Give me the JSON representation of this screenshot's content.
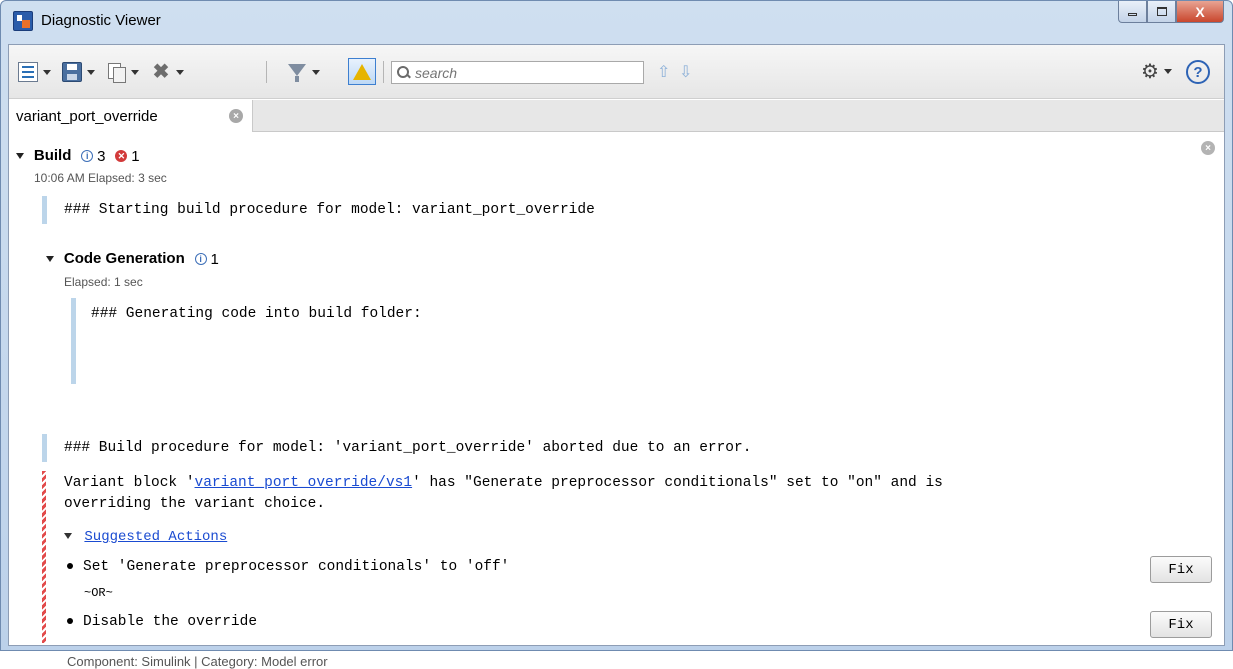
{
  "window": {
    "title": "Diagnostic Viewer",
    "minimize": "",
    "maximize": "",
    "close": "X"
  },
  "toolbar": {
    "search_placeholder": "search",
    "icons": [
      "list-icon",
      "save-icon",
      "copy-icon",
      "delete-icon",
      "filter-icon",
      "warning-toggle-icon",
      "up-arrow-icon",
      "down-arrow-icon",
      "gear-icon",
      "help-icon"
    ],
    "help_label": "?"
  },
  "tabs": [
    {
      "label": "variant_port_override",
      "close": "×"
    }
  ],
  "build": {
    "title": "Build",
    "info_count": "3",
    "error_count": "1",
    "time": "10:06 AM  Elapsed: 3 sec",
    "messages": [
      "### Starting build procedure for model: variant_port_override"
    ],
    "code_generation": {
      "title": "Code Generation",
      "info_count": "1",
      "elapsed": "Elapsed: 1 sec",
      "message": "### Generating code into build folder:"
    },
    "aborted_message": "### Build procedure for model: 'variant_port_override' aborted due to an error.",
    "error": {
      "line1_prefix": "Variant block '",
      "link": "variant_port_override/vs1",
      "line1_suffix": "' has \"Generate preprocessor conditionals\" set to \"on\" and is",
      "line2": "overriding the variant choice.",
      "suggested_actions_label": "Suggested Actions",
      "actions": [
        {
          "text": "Set 'Generate preprocessor conditionals' to 'off'",
          "button": "Fix"
        },
        {
          "text": "Disable the override",
          "button": "Fix"
        }
      ],
      "or_label": "~OR~",
      "footer": "Component: Simulink | Category: Model error"
    }
  },
  "colors": {
    "link": "#1a4bd1",
    "error": "#d23a3a",
    "info": "#3d6fb8",
    "info_bar": "#bcd5ea"
  }
}
